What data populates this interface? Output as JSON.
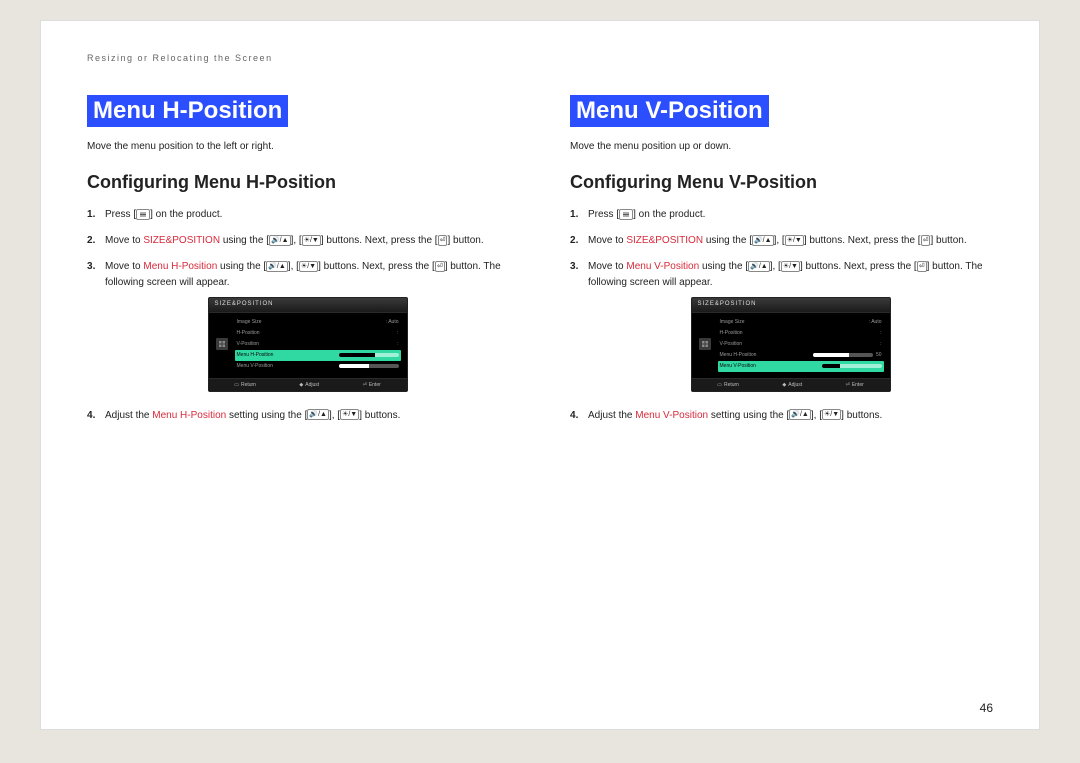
{
  "breadcrumb": "Resizing or Relocating the Screen",
  "pageNumber": "46",
  "left": {
    "title": "Menu H-Position",
    "intro": "Move the menu position to the left or right.",
    "subhead": "Configuring Menu H-Position",
    "steps": {
      "s1a": "Press [",
      "s1b": "] on the product.",
      "s2a": "Move to ",
      "s2b": "SIZE&POSITION",
      "s2c": " using the [",
      "s2d": "], [",
      "s2e": "] buttons. Next, press the [",
      "s2f": "] button.",
      "s3a": "Move to ",
      "s3b": "Menu H-Position",
      "s3c": " using the [",
      "s3d": "], [",
      "s3e": "] buttons. Next, press the [",
      "s3f": "] button. The following screen will appear.",
      "s4a": "Adjust the ",
      "s4b": "Menu H-Position",
      "s4c": " setting using the [",
      "s4d": "], [",
      "s4e": "] buttons."
    },
    "osd": {
      "header": "SIZE&POSITION",
      "rows": [
        {
          "label": "Image Size",
          "value": "Auto"
        },
        {
          "label": "H-Position",
          "value": ""
        },
        {
          "label": "V-Position",
          "value": ""
        },
        {
          "label": "Menu H-Position",
          "value": "",
          "active": true,
          "bar": true,
          "fill": "60%"
        },
        {
          "label": "Menu V-Position",
          "value": "",
          "bar": true,
          "fill": "50%"
        }
      ],
      "footer": [
        "Return",
        "Adjust",
        "Enter"
      ]
    }
  },
  "right": {
    "title": "Menu V-Position",
    "intro": "Move the menu position up or down.",
    "subhead": "Configuring Menu V-Position",
    "steps": {
      "s1a": "Press [",
      "s1b": "] on the product.",
      "s2a": "Move to ",
      "s2b": "SIZE&POSITION",
      "s2c": " using the [",
      "s2d": "], [",
      "s2e": "] buttons. Next, press the [",
      "s2f": "] button.",
      "s3a": "Move to ",
      "s3b": "Menu V-Position",
      "s3c": " using the [",
      "s3d": "], [",
      "s3e": "] buttons. Next, press the [",
      "s3f": "] button. The following screen will appear.",
      "s4a": "Adjust the ",
      "s4b": "Menu V-Position",
      "s4c": " setting using the [",
      "s4d": "], [",
      "s4e": "] buttons."
    },
    "osd": {
      "header": "SIZE&POSITION",
      "rows": [
        {
          "label": "Image Size",
          "value": "Auto"
        },
        {
          "label": "H-Position",
          "value": ""
        },
        {
          "label": "V-Position",
          "value": ""
        },
        {
          "label": "Menu H-Position",
          "value": "50",
          "bar": true,
          "fill": "60%"
        },
        {
          "label": "Menu V-Position",
          "value": "",
          "active": true,
          "bar": true,
          "fill": "30%"
        }
      ],
      "footer": [
        "Return",
        "Adjust",
        "Enter"
      ]
    }
  }
}
